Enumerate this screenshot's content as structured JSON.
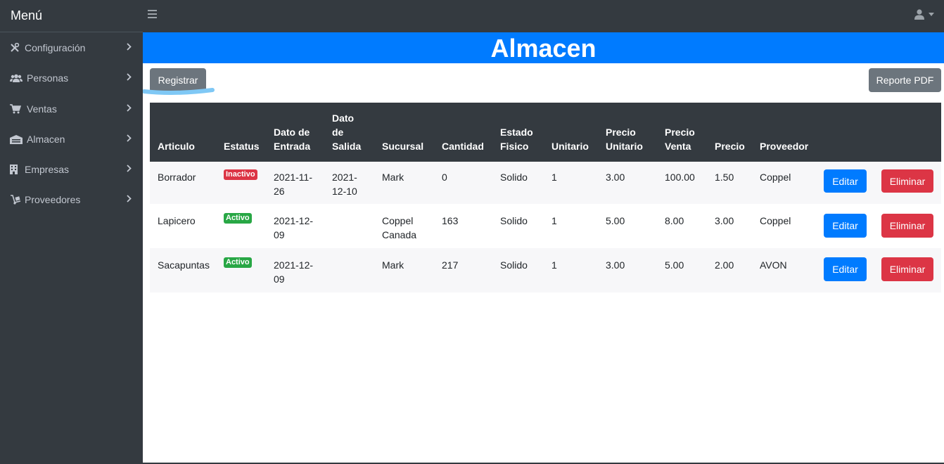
{
  "navbar": {
    "brand": "Menú",
    "menu_icon": "hamburger-icon",
    "user_icon": "user-icon",
    "caret_icon": "caret-down-icon"
  },
  "sidebar": {
    "items": [
      {
        "label": "Configuración",
        "icon": "tools-icon"
      },
      {
        "label": "Personas",
        "icon": "users-icon"
      },
      {
        "label": "Ventas",
        "icon": "cart-icon"
      },
      {
        "label": "Almacen",
        "icon": "warehouse-icon"
      },
      {
        "label": "Empresas",
        "icon": "building-icon"
      },
      {
        "label": "Proveedores",
        "icon": "dolly-icon"
      }
    ]
  },
  "page": {
    "title": "Almacen",
    "register_label": "Registrar",
    "report_label": "Reporte PDF"
  },
  "table": {
    "headers": {
      "articulo": "Articulo",
      "estatus": "Estatus",
      "dato_entrada": "Dato de Entrada",
      "dato_salida": "Dato de Salida",
      "sucursal": "Sucursal",
      "cantidad": "Cantidad",
      "estado_fisico": "Estado Fisico",
      "unitario": "Unitario",
      "precio_unitario": "Precio Unitario",
      "precio_venta": "Precio Venta",
      "precio": "Precio",
      "proveedor": "Proveedor"
    },
    "rows": [
      {
        "articulo": "Borrador",
        "estatus": "Inactivo",
        "dato_entrada": "2021-11-26",
        "dato_salida": "2021-12-10",
        "sucursal": "Mark",
        "cantidad": "0",
        "estado_fisico": "Solido",
        "unitario": "1",
        "precio_unitario": "3.00",
        "precio_venta": "100.00",
        "precio": "1.50",
        "proveedor": "Coppel",
        "edit": "Editar",
        "delete": "Eliminar"
      },
      {
        "articulo": "Lapicero",
        "estatus": "Activo",
        "dato_entrada": "2021-12-09",
        "dato_salida": "",
        "sucursal": "Coppel Canada",
        "cantidad": "163",
        "estado_fisico": "Solido",
        "unitario": "1",
        "precio_unitario": "5.00",
        "precio_venta": "8.00",
        "precio": "3.00",
        "proveedor": "Coppel",
        "edit": "Editar",
        "delete": "Eliminar"
      },
      {
        "articulo": "Sacapuntas",
        "estatus": "Activo",
        "dato_entrada": "2021-12-09",
        "dato_salida": "",
        "sucursal": "Mark",
        "cantidad": "217",
        "estado_fisico": "Solido",
        "unitario": "1",
        "precio_unitario": "3.00",
        "precio_venta": "5.00",
        "precio": "2.00",
        "proveedor": "AVON",
        "edit": "Editar",
        "delete": "Eliminar"
      }
    ]
  },
  "colors": {
    "primary": "#007bff",
    "danger": "#dc3545",
    "success": "#28a745",
    "secondary": "#6c757d",
    "dark": "#343a40"
  }
}
